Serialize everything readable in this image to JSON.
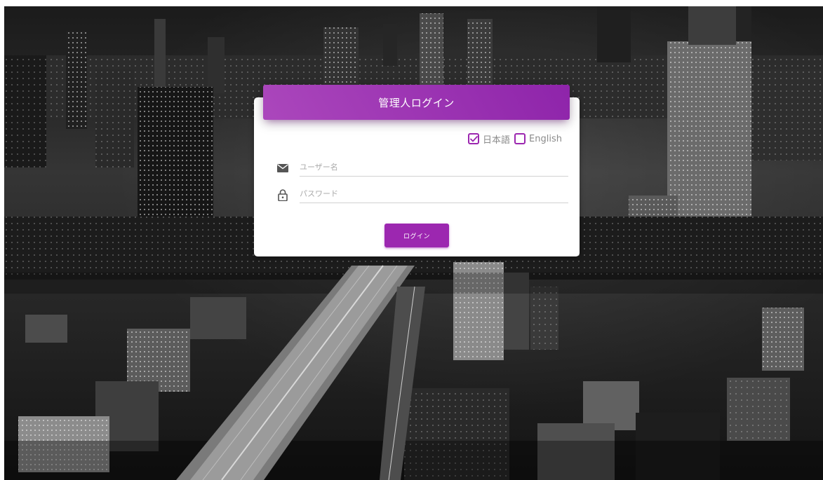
{
  "login": {
    "title": "管理人ログイン",
    "languages": [
      {
        "label": "日本語",
        "checked": true
      },
      {
        "label": "English",
        "checked": false
      }
    ],
    "username": {
      "placeholder": "ユーザー名",
      "value": "",
      "icon": "mail-icon"
    },
    "password": {
      "placeholder": "パスワード",
      "value": "",
      "icon": "lock-icon"
    },
    "submit_label": "ログイン"
  },
  "colors": {
    "accent": "#9c27b0",
    "accent_light": "#ab47bc",
    "accent_dark": "#8e24aa",
    "card": "#ffffff",
    "input_border": "#d2d2d2",
    "placeholder": "#aaaaaa",
    "icon": "#555555"
  },
  "background": {
    "icon": "city-night-photo"
  }
}
